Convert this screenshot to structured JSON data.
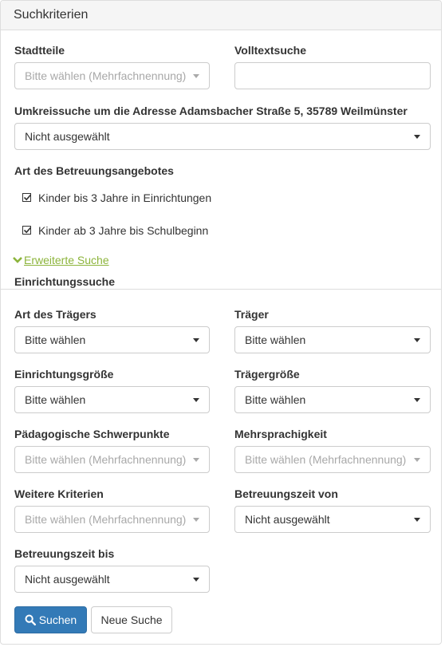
{
  "panel": {
    "title": "Suchkriterien"
  },
  "fields": {
    "stadtteile": {
      "label": "Stadtteile",
      "placeholder": "Bitte wählen (Mehrfachnennung)"
    },
    "volltext": {
      "label": "Volltextsuche",
      "value": ""
    },
    "umkreis": {
      "label": "Umkreissuche um die Adresse Adamsbacher Straße 5, 35789 Weilmünster",
      "value": "Nicht ausgewählt"
    },
    "art_betreuung": {
      "label": "Art des Betreuungsangebotes",
      "options": [
        {
          "label": "Kinder bis 3 Jahre in Einrichtungen",
          "checked": true
        },
        {
          "label": "Kinder ab 3 Jahre bis Schulbeginn",
          "checked": true
        }
      ]
    }
  },
  "extended_search": {
    "label": "Erweiterte Suche",
    "icon": "chevron-down-icon",
    "color": "#8cb43b"
  },
  "section": {
    "title": "Einrichtungssuche"
  },
  "filters": {
    "art_traeger": {
      "label": "Art des Trägers",
      "value": "Bitte wählen"
    },
    "traeger": {
      "label": "Träger",
      "value": "Bitte wählen"
    },
    "einrichtungsgroesse": {
      "label": "Einrichtungsgröße",
      "value": "Bitte wählen"
    },
    "traegergroesse": {
      "label": "Trägergröße",
      "value": "Bitte wählen"
    },
    "schwerpunkte": {
      "label": "Pädagogische Schwerpunkte",
      "placeholder": "Bitte wählen (Mehrfachnennung)"
    },
    "mehrsprachigkeit": {
      "label": "Mehrsprachigkeit",
      "placeholder": "Bitte wählen (Mehrfachnennung)"
    },
    "weitere": {
      "label": "Weitere Kriterien",
      "placeholder": "Bitte wählen (Mehrfachnennung)"
    },
    "zeit_von": {
      "label": "Betreuungszeit von",
      "value": "Nicht ausgewählt"
    },
    "zeit_bis": {
      "label": "Betreuungszeit bis",
      "value": "Nicht ausgewählt"
    }
  },
  "buttons": {
    "search": {
      "label": "Suchen",
      "icon": "search-icon",
      "color": "#337ab7"
    },
    "reset": {
      "label": "Neue Suche"
    }
  }
}
